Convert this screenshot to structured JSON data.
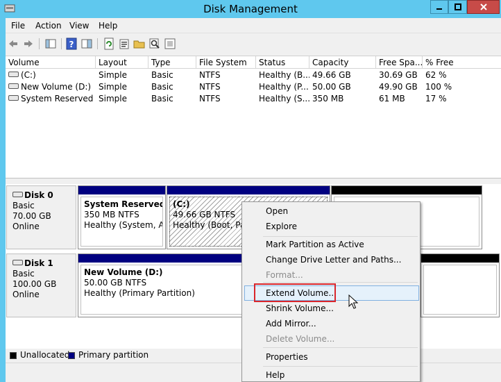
{
  "window": {
    "title": "Disk Management"
  },
  "menu": [
    "File",
    "Action",
    "View",
    "Help"
  ],
  "icons": [
    "back-arrow-icon",
    "forward-arrow-icon",
    "console-tree-icon",
    "help-icon",
    "show-pane-icon",
    "refresh-icon",
    "properties-icon",
    "open-folder-icon",
    "search-icon",
    "export-icon"
  ],
  "volumes": {
    "headers": [
      "Volume",
      "Layout",
      "Type",
      "File System",
      "Status",
      "Capacity",
      "Free Spa...",
      "% Free"
    ],
    "rows": [
      {
        "volume": "(C:)",
        "layout": "Simple",
        "type": "Basic",
        "fs": "NTFS",
        "status": "Healthy (B...",
        "capacity": "49.66 GB",
        "free": "30.69 GB",
        "pct": "62 %"
      },
      {
        "volume": "New Volume (D:)",
        "layout": "Simple",
        "type": "Basic",
        "fs": "NTFS",
        "status": "Healthy (P...",
        "capacity": "50.00 GB",
        "free": "49.90 GB",
        "pct": "100 %"
      },
      {
        "volume": "System Reserved",
        "layout": "Simple",
        "type": "Basic",
        "fs": "NTFS",
        "status": "Healthy (S...",
        "capacity": "350 MB",
        "free": "61 MB",
        "pct": "17 %"
      }
    ]
  },
  "disks": [
    {
      "name": "Disk 0",
      "type": "Basic",
      "size": "70.00 GB",
      "state": "Online",
      "partitions": [
        {
          "name": "System Reserved",
          "size": "350 MB NTFS",
          "status": "Healthy (System, Acti"
        },
        {
          "name": "(C:)",
          "size": "49.66 GB NTFS",
          "status": "Healthy (Boot, Pag"
        }
      ]
    },
    {
      "name": "Disk 1",
      "type": "Basic",
      "size": "100.00 GB",
      "state": "Online",
      "partitions": [
        {
          "name": "New Volume  (D:)",
          "size": "50.00 GB NTFS",
          "status": "Healthy (Primary Partition)"
        }
      ]
    }
  ],
  "legend": [
    {
      "label": "Unallocated",
      "color": "#000000"
    },
    {
      "label": "Primary partition",
      "color": "#000080"
    }
  ],
  "context_menu": {
    "open": "Open",
    "explore": "Explore",
    "mark_active": "Mark Partition as Active",
    "change_letter": "Change Drive Letter and Paths...",
    "format": "Format...",
    "extend": "Extend Volume...",
    "shrink": "Shrink Volume...",
    "add_mirror": "Add Mirror...",
    "delete": "Delete Volume...",
    "properties": "Properties",
    "help": "Help"
  },
  "colors": {
    "titlebar": "#5fc8ee",
    "primary_partition": "#000080",
    "highlight_box": "#d9262c"
  }
}
